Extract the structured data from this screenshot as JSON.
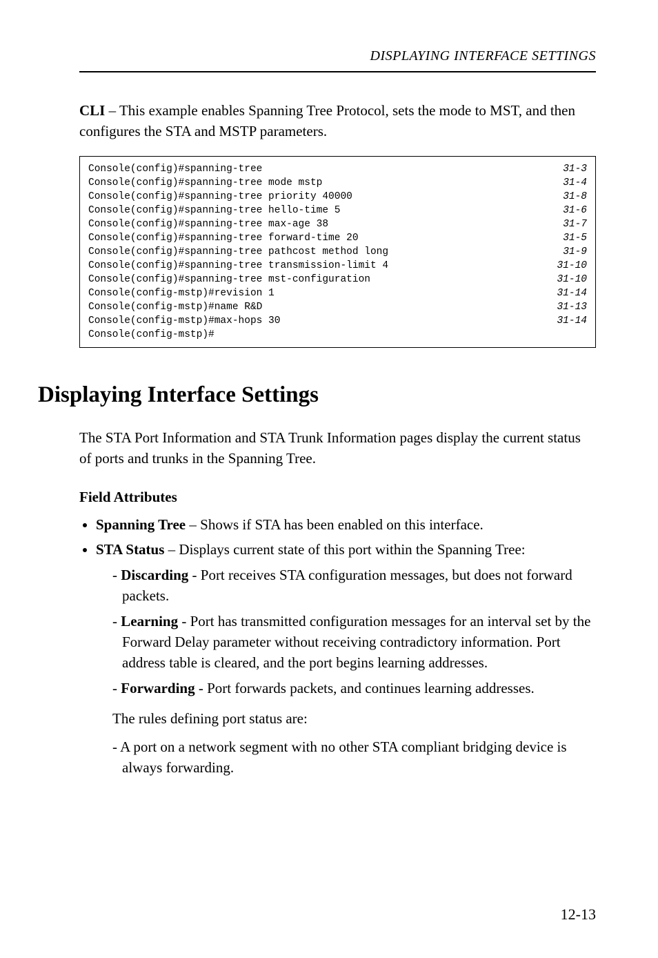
{
  "header": {
    "running": "DISPLAYING INTERFACE SETTINGS"
  },
  "intro": {
    "bold": "CLI",
    "rest": " – This example enables Spanning Tree Protocol, sets the mode to MST, and then configures the STA and MSTP parameters."
  },
  "cli": [
    {
      "cmd": "Console(config)#spanning-tree",
      "ref": "31-3"
    },
    {
      "cmd": "Console(config)#spanning-tree mode mstp",
      "ref": "31-4"
    },
    {
      "cmd": "Console(config)#spanning-tree priority 40000",
      "ref": "31-8"
    },
    {
      "cmd": "Console(config)#spanning-tree hello-time 5",
      "ref": "31-6"
    },
    {
      "cmd": "Console(config)#spanning-tree max-age 38",
      "ref": "31-7"
    },
    {
      "cmd": "Console(config)#spanning-tree forward-time 20",
      "ref": "31-5"
    },
    {
      "cmd": "Console(config)#spanning-tree pathcost method long",
      "ref": "31-9"
    },
    {
      "cmd": "Console(config)#spanning-tree transmission-limit 4",
      "ref": "31-10"
    },
    {
      "cmd": "Console(config)#spanning-tree mst-configuration",
      "ref": "31-10"
    },
    {
      "cmd": "Console(config-mstp)#revision 1",
      "ref": "31-14"
    },
    {
      "cmd": "Console(config-mstp)#name R&D",
      "ref": "31-13"
    },
    {
      "cmd": "Console(config-mstp)#max-hops 30",
      "ref": "31-14"
    },
    {
      "cmd": "Console(config-mstp)#"
    }
  ],
  "section": {
    "title": "Displaying Interface Settings",
    "body": "The STA Port Information and STA Trunk Information pages display the current status of ports and trunks in the Spanning Tree."
  },
  "fields": {
    "heading": "Field Attributes",
    "items": [
      {
        "name": "Spanning Tree",
        "desc": " – Shows if STA has been enabled on this interface."
      },
      {
        "name": "STA Status",
        "desc": " – Displays current state of this port within the Spanning Tree:",
        "states": [
          {
            "name": "Discarding",
            "desc": " - Port receives STA configuration messages, but does not forward packets."
          },
          {
            "name": "Learning",
            "desc": " - Port has transmitted configuration messages for an interval set by the Forward Delay parameter without receiving contradictory information. Port address table is cleared, and the port begins learning addresses."
          },
          {
            "name": "Forwarding",
            "desc": " - Port forwards packets, and continues learning addresses."
          }
        ],
        "rules_intro": "The rules defining port status are:",
        "rules": [
          "A port on a network segment with no other STA compliant bridging device is always forwarding."
        ]
      }
    ]
  },
  "page": {
    "number": "12-13"
  }
}
